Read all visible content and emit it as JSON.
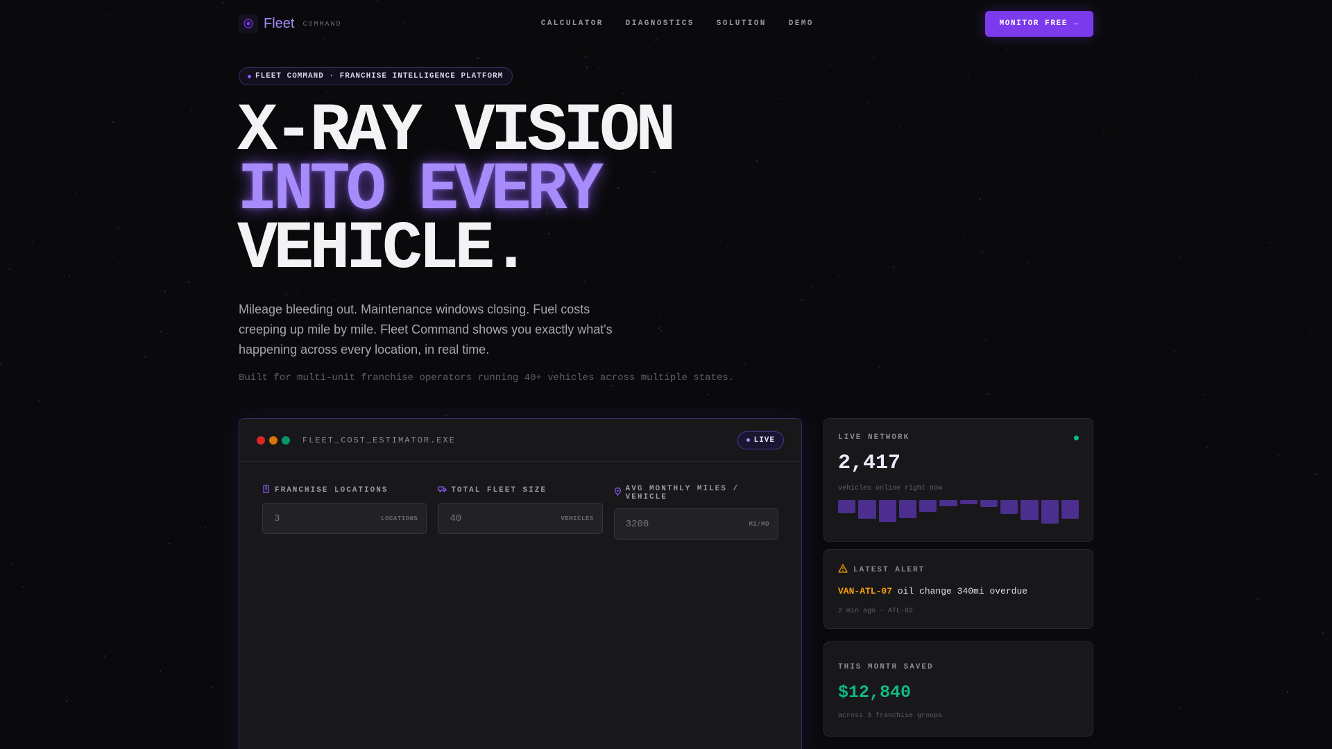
{
  "nav": {
    "brand_name": "Fleet",
    "brand_sub": "COMMAND",
    "links": [
      "CALCULATOR",
      "DIAGNOSTICS",
      "SOLUTION",
      "DEMO"
    ],
    "cta_label": "MONITOR FREE →"
  },
  "hero": {
    "badge": "FLEET COMMAND · FRANCHISE INTELLIGENCE PLATFORM",
    "headline_line1": "X-RAY VISION",
    "headline_line2": "INTO EVERY",
    "headline_line3": "VEHICLE.",
    "lede": "Mileage bleeding out. Maintenance windows closing. Fuel costs creeping up mile by mile. Fleet Command shows you exactly what's happening across every location, in real time.",
    "subnote": "Built for multi-unit franchise operators running 40+ vehicles across multiple states."
  },
  "calculator": {
    "title": "FLEET_COST_ESTIMATOR.EXE",
    "status": "LIVE",
    "fields": [
      {
        "label": "FRANCHISE LOCATIONS",
        "placeholder": "3",
        "unit": "LOCATIONS",
        "icon": "building-icon"
      },
      {
        "label": "TOTAL FLEET SIZE",
        "placeholder": "40",
        "unit": "VEHICLES",
        "icon": "truck-icon"
      },
      {
        "label": "AVG MONTHLY MILES / VEHICLE",
        "placeholder": "3200",
        "unit": "MI/MO",
        "icon": "map-pin-icon"
      }
    ]
  },
  "network_card": {
    "label": "LIVE NETWORK",
    "value": "2,417",
    "sub": "vehicles online right now",
    "activity_levels": [
      0.55,
      0.8,
      0.95,
      0.75,
      0.5,
      0.25,
      0.15,
      0.3,
      0.6,
      0.85,
      1.0,
      0.8
    ]
  },
  "alert_card": {
    "label": "LATEST ALERT",
    "vehicle": "VAN-ATL-07",
    "message": "oil change 340mi overdue",
    "meta": "2 min ago · ATL-02"
  },
  "savings_card": {
    "label": "THIS MONTH SAVED",
    "value": "$12,840",
    "sub": "across 3 franchise groups"
  },
  "colors": {
    "accent": "#7c3aed",
    "accent_light": "#a78bfa",
    "success": "#10b981",
    "warning": "#f59e0b",
    "background": "#0a0a0c"
  }
}
